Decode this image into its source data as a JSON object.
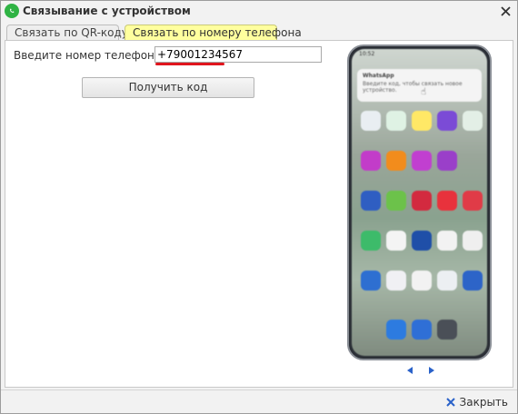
{
  "window": {
    "title": "Связывание с устройством",
    "close_icon": "close-icon",
    "app_icon": "whatsapp-icon"
  },
  "tabs": [
    {
      "label": "Связать по QR-коду",
      "active": false
    },
    {
      "label": "Связать по номеру телефона",
      "active": true
    }
  ],
  "form": {
    "phone_label": "Введите номер телефона:",
    "phone_value": "+79001234567",
    "get_code_label": "Получить код"
  },
  "phone_preview": {
    "status_time": "10:52",
    "notification_app": "WhatsApp",
    "notification_text": "Введите код, чтобы связать новое устройство."
  },
  "pager": {
    "prev_icon": "arrow-left-icon",
    "next_icon": "arrow-right-icon"
  },
  "footer": {
    "close_label": "Закрыть",
    "close_icon": "close-x-icon"
  },
  "colors": {
    "active_tab": "#ffff9e",
    "underline": "#e0151d",
    "whatsapp": "#2fb344",
    "arrow": "#2a62c9"
  }
}
